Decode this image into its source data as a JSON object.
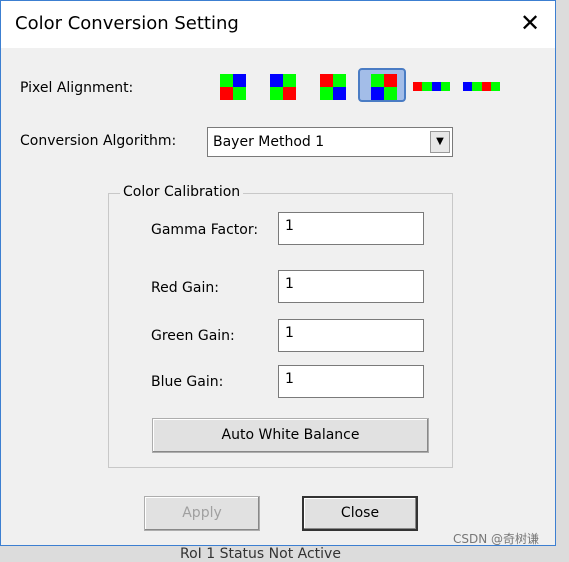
{
  "dialog": {
    "title": "Color Conversion Setting"
  },
  "pixel_alignment": {
    "label": "Pixel Alignment:",
    "selected_index": 3,
    "options": [
      [
        "#00ff00",
        "#0000ff",
        "#ff0000",
        "#00ff00"
      ],
      [
        "#0000ff",
        "#00ff00",
        "#00ff00",
        "#ff0000"
      ],
      [
        "#ff0000",
        "#00ff00",
        "#00ff00",
        "#0000ff"
      ],
      [
        "#00ff00",
        "#ff0000",
        "#0000ff",
        "#00ff00"
      ]
    ],
    "strips": [
      [
        "#ff0000",
        "#00ff00",
        "#0000ff",
        "#00ff00"
      ],
      [
        "#0000ff",
        "#00ff00",
        "#ff0000",
        "#00ff00"
      ]
    ]
  },
  "conversion": {
    "label": "Conversion Algorithm:",
    "value": "Bayer Method 1"
  },
  "calibration": {
    "title": "Color Calibration",
    "gamma": {
      "label": "Gamma Factor:",
      "value": "1"
    },
    "red": {
      "label": "Red Gain:",
      "value": "1"
    },
    "green": {
      "label": "Green Gain:",
      "value": "1"
    },
    "blue": {
      "label": "Blue Gain:",
      "value": "1"
    },
    "awb": "Auto White Balance"
  },
  "buttons": {
    "apply": "Apply",
    "close": "Close"
  },
  "watermark": "CSDN @奇树谦",
  "background": {
    "text": "RoI 1 Status        Not Active"
  }
}
